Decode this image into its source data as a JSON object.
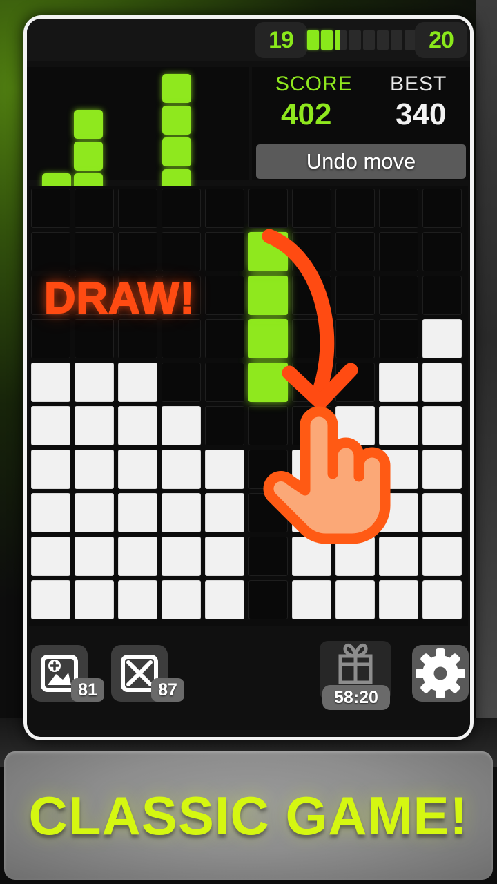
{
  "header": {
    "level_current": "19",
    "level_next": "20",
    "progress_segments": 8,
    "progress_filled": 2,
    "progress_partial": true,
    "accent_green": "#8fe81e"
  },
  "tray": {
    "pieces": [
      {
        "name": "l-piece",
        "cells": [
          [
            1,
            0
          ],
          [
            1,
            1
          ],
          [
            1,
            2
          ],
          [
            0,
            2
          ]
        ]
      },
      {
        "name": "i-piece",
        "cells": [
          [
            0,
            0
          ],
          [
            0,
            1
          ],
          [
            0,
            2
          ],
          [
            0,
            3
          ]
        ]
      }
    ]
  },
  "score_panel": {
    "score_label": "SCORE",
    "score_value": "402",
    "best_label": "BEST",
    "best_value": "340",
    "undo_label": "Undo move"
  },
  "board": {
    "rows": 10,
    "cols": 10,
    "legend": {
      "0": "empty",
      "1": "white",
      "2": "green"
    },
    "grid": [
      [
        0,
        0,
        0,
        0,
        0,
        0,
        0,
        0,
        0,
        0
      ],
      [
        0,
        0,
        0,
        0,
        0,
        2,
        0,
        0,
        0,
        0
      ],
      [
        0,
        0,
        0,
        0,
        0,
        2,
        0,
        0,
        0,
        0
      ],
      [
        0,
        0,
        0,
        0,
        0,
        2,
        0,
        0,
        0,
        1
      ],
      [
        1,
        1,
        1,
        0,
        0,
        2,
        0,
        0,
        1,
        1
      ],
      [
        1,
        1,
        1,
        1,
        0,
        0,
        0,
        1,
        1,
        1
      ],
      [
        1,
        1,
        1,
        1,
        1,
        0,
        1,
        1,
        1,
        1
      ],
      [
        1,
        1,
        1,
        1,
        1,
        0,
        1,
        1,
        1,
        1
      ],
      [
        1,
        1,
        1,
        1,
        1,
        0,
        1,
        1,
        1,
        1
      ],
      [
        1,
        1,
        1,
        1,
        1,
        0,
        1,
        1,
        1,
        1
      ]
    ]
  },
  "callout": {
    "draw_text": "DRAW!",
    "draw_color": "#ff4b12"
  },
  "toolbar": {
    "boost1_icon": "add-block-icon",
    "boost1_count": "81",
    "boost2_icon": "delete-block-icon",
    "boost2_count": "87",
    "gift_icon": "gift-icon",
    "gift_timer": "58:20",
    "settings_icon": "gear-icon"
  },
  "banner": {
    "text": "CLASSIC GAME!",
    "color": "#d5f711"
  }
}
